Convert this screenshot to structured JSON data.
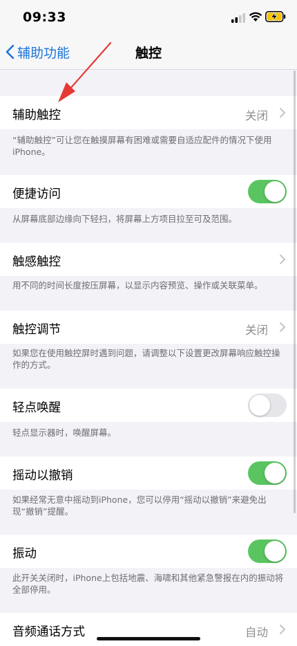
{
  "status": {
    "time": "09:33"
  },
  "nav": {
    "back_label": "辅助功能",
    "title": "触控"
  },
  "rows": {
    "assistive_touch": {
      "label": "辅助触控",
      "value": "关闭",
      "footer": "“辅助触控”可让您在触摸屏幕有困难或需要自适应配件的情况下使用iPhone。"
    },
    "reachability": {
      "label": "便捷访问",
      "toggle": "on",
      "footer": "从屏幕底部边缘向下轻扫，将屏幕上方项目拉至可及范围。"
    },
    "haptic_touch": {
      "label": "触感触控",
      "footer": "用不同的时间长度按压屏幕，以显示内容预览、操作或关联菜单。"
    },
    "touch_accommodations": {
      "label": "触控调节",
      "value": "关闭",
      "footer": "如果您在使用触控屏时遇到问题，请调整以下设置更改屏幕响应触控操作的方式。"
    },
    "tap_to_wake": {
      "label": "轻点唤醒",
      "toggle": "off",
      "footer": "轻点显示器时，唤醒屏幕。"
    },
    "shake_to_undo": {
      "label": "摇动以撤销",
      "toggle": "on",
      "footer": "如果经常无意中摇动到iPhone，您可以停用“摇动以撤销”来避免出现“撤销”提醒。"
    },
    "vibration": {
      "label": "振动",
      "toggle": "on",
      "footer": "此开关关闭时，iPhone上包括地震、海啸和其他紧急警报在内的振动将全部停用。"
    },
    "call_audio_routing": {
      "label": "音频通话方式",
      "value": "自动"
    }
  },
  "colors": {
    "accent": "#1a74d8",
    "toggle_on": "#5ac560",
    "arrow": "#e53935"
  },
  "icons": [
    "signal-icon",
    "wifi-icon",
    "battery-charging-icon",
    "back-chevron-icon",
    "chevron-right-icon",
    "annotation-arrow"
  ]
}
